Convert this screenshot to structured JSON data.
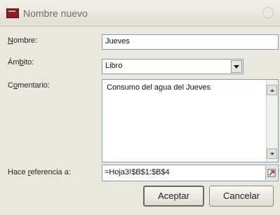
{
  "window": {
    "title": "Nombre nuevo"
  },
  "fields": {
    "nombre": {
      "label_pre": "",
      "label_u": "N",
      "label_post": "ombre:",
      "value": "Jueves"
    },
    "ambito": {
      "label_pre": "Ám",
      "label_u": "b",
      "label_post": "ito:",
      "value": "Libro"
    },
    "comentario": {
      "label_pre": "C",
      "label_u": "o",
      "label_post": "mentario:",
      "value": "Consumo del agua del Jueves"
    },
    "referencia": {
      "label_pre": "Hace ",
      "label_u": "r",
      "label_post": "eferencia a:",
      "value": "=Hoja3!$B$1:$B$4"
    }
  },
  "buttons": {
    "accept": "Aceptar",
    "cancel": "Cancelar"
  },
  "colors": {
    "field_border": "#7f9db9",
    "dialog_bg": "#ebe8de",
    "title_icon": "#8b1e22"
  }
}
